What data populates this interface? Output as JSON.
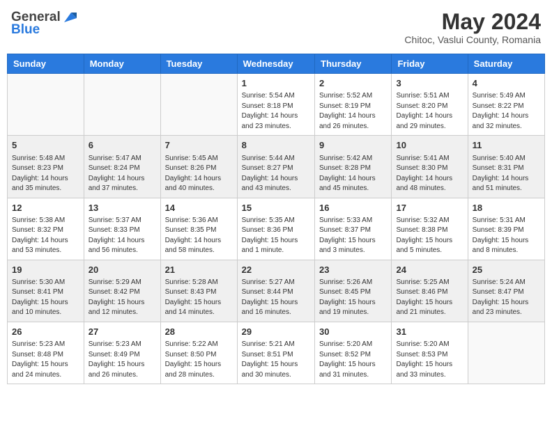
{
  "header": {
    "logo_general": "General",
    "logo_blue": "Blue",
    "month_title": "May 2024",
    "subtitle": "Chitoc, Vaslui County, Romania"
  },
  "weekdays": [
    "Sunday",
    "Monday",
    "Tuesday",
    "Wednesday",
    "Thursday",
    "Friday",
    "Saturday"
  ],
  "weeks": [
    [
      {
        "day": "",
        "sunrise": "",
        "sunset": "",
        "daylight": ""
      },
      {
        "day": "",
        "sunrise": "",
        "sunset": "",
        "daylight": ""
      },
      {
        "day": "",
        "sunrise": "",
        "sunset": "",
        "daylight": ""
      },
      {
        "day": "1",
        "sunrise": "Sunrise: 5:54 AM",
        "sunset": "Sunset: 8:18 PM",
        "daylight": "Daylight: 14 hours and 23 minutes."
      },
      {
        "day": "2",
        "sunrise": "Sunrise: 5:52 AM",
        "sunset": "Sunset: 8:19 PM",
        "daylight": "Daylight: 14 hours and 26 minutes."
      },
      {
        "day": "3",
        "sunrise": "Sunrise: 5:51 AM",
        "sunset": "Sunset: 8:20 PM",
        "daylight": "Daylight: 14 hours and 29 minutes."
      },
      {
        "day": "4",
        "sunrise": "Sunrise: 5:49 AM",
        "sunset": "Sunset: 8:22 PM",
        "daylight": "Daylight: 14 hours and 32 minutes."
      }
    ],
    [
      {
        "day": "5",
        "sunrise": "Sunrise: 5:48 AM",
        "sunset": "Sunset: 8:23 PM",
        "daylight": "Daylight: 14 hours and 35 minutes."
      },
      {
        "day": "6",
        "sunrise": "Sunrise: 5:47 AM",
        "sunset": "Sunset: 8:24 PM",
        "daylight": "Daylight: 14 hours and 37 minutes."
      },
      {
        "day": "7",
        "sunrise": "Sunrise: 5:45 AM",
        "sunset": "Sunset: 8:26 PM",
        "daylight": "Daylight: 14 hours and 40 minutes."
      },
      {
        "day": "8",
        "sunrise": "Sunrise: 5:44 AM",
        "sunset": "Sunset: 8:27 PM",
        "daylight": "Daylight: 14 hours and 43 minutes."
      },
      {
        "day": "9",
        "sunrise": "Sunrise: 5:42 AM",
        "sunset": "Sunset: 8:28 PM",
        "daylight": "Daylight: 14 hours and 45 minutes."
      },
      {
        "day": "10",
        "sunrise": "Sunrise: 5:41 AM",
        "sunset": "Sunset: 8:30 PM",
        "daylight": "Daylight: 14 hours and 48 minutes."
      },
      {
        "day": "11",
        "sunrise": "Sunrise: 5:40 AM",
        "sunset": "Sunset: 8:31 PM",
        "daylight": "Daylight: 14 hours and 51 minutes."
      }
    ],
    [
      {
        "day": "12",
        "sunrise": "Sunrise: 5:38 AM",
        "sunset": "Sunset: 8:32 PM",
        "daylight": "Daylight: 14 hours and 53 minutes."
      },
      {
        "day": "13",
        "sunrise": "Sunrise: 5:37 AM",
        "sunset": "Sunset: 8:33 PM",
        "daylight": "Daylight: 14 hours and 56 minutes."
      },
      {
        "day": "14",
        "sunrise": "Sunrise: 5:36 AM",
        "sunset": "Sunset: 8:35 PM",
        "daylight": "Daylight: 14 hours and 58 minutes."
      },
      {
        "day": "15",
        "sunrise": "Sunrise: 5:35 AM",
        "sunset": "Sunset: 8:36 PM",
        "daylight": "Daylight: 15 hours and 1 minute."
      },
      {
        "day": "16",
        "sunrise": "Sunrise: 5:33 AM",
        "sunset": "Sunset: 8:37 PM",
        "daylight": "Daylight: 15 hours and 3 minutes."
      },
      {
        "day": "17",
        "sunrise": "Sunrise: 5:32 AM",
        "sunset": "Sunset: 8:38 PM",
        "daylight": "Daylight: 15 hours and 5 minutes."
      },
      {
        "day": "18",
        "sunrise": "Sunrise: 5:31 AM",
        "sunset": "Sunset: 8:39 PM",
        "daylight": "Daylight: 15 hours and 8 minutes."
      }
    ],
    [
      {
        "day": "19",
        "sunrise": "Sunrise: 5:30 AM",
        "sunset": "Sunset: 8:41 PM",
        "daylight": "Daylight: 15 hours and 10 minutes."
      },
      {
        "day": "20",
        "sunrise": "Sunrise: 5:29 AM",
        "sunset": "Sunset: 8:42 PM",
        "daylight": "Daylight: 15 hours and 12 minutes."
      },
      {
        "day": "21",
        "sunrise": "Sunrise: 5:28 AM",
        "sunset": "Sunset: 8:43 PM",
        "daylight": "Daylight: 15 hours and 14 minutes."
      },
      {
        "day": "22",
        "sunrise": "Sunrise: 5:27 AM",
        "sunset": "Sunset: 8:44 PM",
        "daylight": "Daylight: 15 hours and 16 minutes."
      },
      {
        "day": "23",
        "sunrise": "Sunrise: 5:26 AM",
        "sunset": "Sunset: 8:45 PM",
        "daylight": "Daylight: 15 hours and 19 minutes."
      },
      {
        "day": "24",
        "sunrise": "Sunrise: 5:25 AM",
        "sunset": "Sunset: 8:46 PM",
        "daylight": "Daylight: 15 hours and 21 minutes."
      },
      {
        "day": "25",
        "sunrise": "Sunrise: 5:24 AM",
        "sunset": "Sunset: 8:47 PM",
        "daylight": "Daylight: 15 hours and 23 minutes."
      }
    ],
    [
      {
        "day": "26",
        "sunrise": "Sunrise: 5:23 AM",
        "sunset": "Sunset: 8:48 PM",
        "daylight": "Daylight: 15 hours and 24 minutes."
      },
      {
        "day": "27",
        "sunrise": "Sunrise: 5:23 AM",
        "sunset": "Sunset: 8:49 PM",
        "daylight": "Daylight: 15 hours and 26 minutes."
      },
      {
        "day": "28",
        "sunrise": "Sunrise: 5:22 AM",
        "sunset": "Sunset: 8:50 PM",
        "daylight": "Daylight: 15 hours and 28 minutes."
      },
      {
        "day": "29",
        "sunrise": "Sunrise: 5:21 AM",
        "sunset": "Sunset: 8:51 PM",
        "daylight": "Daylight: 15 hours and 30 minutes."
      },
      {
        "day": "30",
        "sunrise": "Sunrise: 5:20 AM",
        "sunset": "Sunset: 8:52 PM",
        "daylight": "Daylight: 15 hours and 31 minutes."
      },
      {
        "day": "31",
        "sunrise": "Sunrise: 5:20 AM",
        "sunset": "Sunset: 8:53 PM",
        "daylight": "Daylight: 15 hours and 33 minutes."
      },
      {
        "day": "",
        "sunrise": "",
        "sunset": "",
        "daylight": ""
      }
    ]
  ]
}
